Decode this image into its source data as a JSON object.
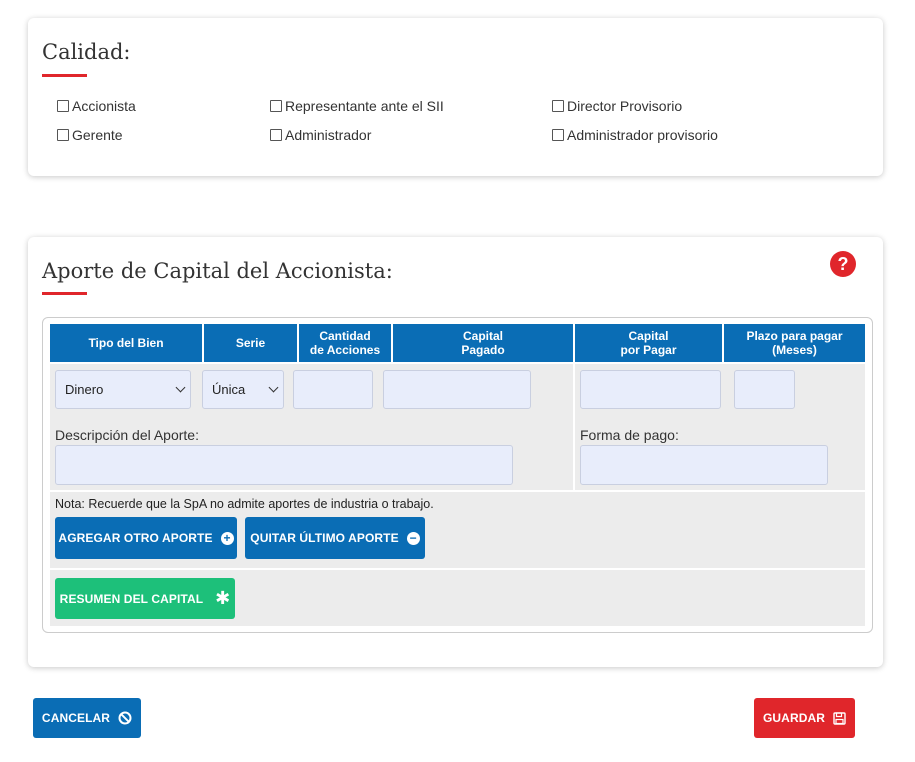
{
  "calidad": {
    "title": "Calidad:",
    "options": [
      {
        "label": "Accionista",
        "checked": false
      },
      {
        "label": "Representante ante el SII",
        "checked": false
      },
      {
        "label": "Director Provisorio",
        "checked": false
      },
      {
        "label": "Gerente",
        "checked": false
      },
      {
        "label": "Administrador",
        "checked": false
      },
      {
        "label": "Administrador provisorio",
        "checked": false
      }
    ]
  },
  "aporte": {
    "title": "Aporte de Capital del Accionista:",
    "help_icon": "question-circle-icon",
    "table": {
      "headers": [
        "Tipo del Bien",
        "Serie",
        "Cantidad\nde Acciones",
        "Capital\nPagado",
        "Capital\npor Pagar",
        "Plazo para pagar\n(Meses)"
      ],
      "tipo_bien_value": "Dinero",
      "serie_value": "Única",
      "cantidad_acciones_value": "",
      "capital_pagado_value": "",
      "capital_por_pagar_value": "",
      "plazo_value": "",
      "descripcion_label": "Descripción del Aporte:",
      "descripcion_value": "",
      "forma_pago_label": "Forma de pago:",
      "forma_pago_value": ""
    },
    "note": "Nota: Recuerde que la SpA no admite aportes de industria o trabajo.",
    "add_button": "AGREGAR OTRO APORTE",
    "remove_button": "QUITAR ÚLTIMO APORTE",
    "summary_button": "RESUMEN DEL CAPITAL"
  },
  "footer": {
    "cancel_button": "CANCELAR",
    "save_button": "GUARDAR"
  },
  "colors": {
    "primary_blue": "#0a6db5",
    "accent_red": "#e0262b",
    "success_green": "#1dc07a",
    "input_bg": "#e8edfb"
  }
}
